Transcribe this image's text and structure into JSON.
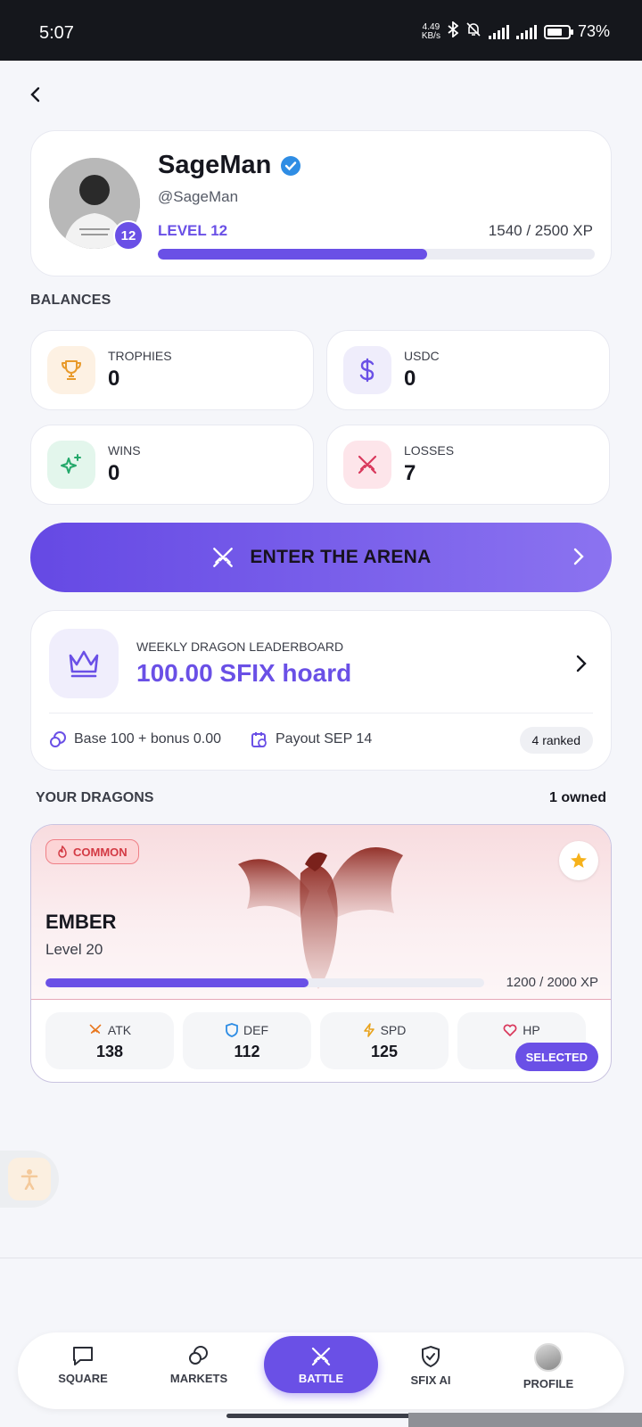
{
  "status_bar": {
    "time": "5:07",
    "net_speed_value": "4.49",
    "net_speed_unit": "KB/s",
    "battery": "73%"
  },
  "profile": {
    "name": "SageMan",
    "handle": "@SageMan",
    "level_badge": "12",
    "level_label": "LEVEL 12",
    "xp_text": "1540 / 2500 XP",
    "xp_current": 1540,
    "xp_max": 2500
  },
  "balances": {
    "title": "BALANCES",
    "items": [
      {
        "label": "TROPHIES",
        "value": "0",
        "icon": "trophy-icon"
      },
      {
        "label": "USDC",
        "value": "0",
        "icon": "dollar-icon"
      },
      {
        "label": "WINS",
        "value": "0",
        "icon": "sparkle-icon"
      },
      {
        "label": "LOSSES",
        "value": "7",
        "icon": "swords-icon"
      }
    ]
  },
  "arena": {
    "label": "ENTER THE ARENA"
  },
  "leaderboard": {
    "label": "WEEKLY DRAGON LEADERBOARD",
    "value": "100.00 SFIX hoard",
    "base": "Base 100 + bonus 0.00",
    "payout": "Payout SEP 14",
    "ranked": "4 ranked"
  },
  "dragons": {
    "title": "YOUR DRAGONS",
    "owned": "1 owned",
    "card": {
      "rarity": "COMMON",
      "name": "EMBER",
      "level": "Level 20",
      "xp_text": "1200 / 2000 XP",
      "xp_current": 1200,
      "xp_max": 2000,
      "stats": [
        {
          "label": "ATK",
          "value": "138"
        },
        {
          "label": "DEF",
          "value": "112"
        },
        {
          "label": "SPD",
          "value": "125"
        },
        {
          "label": "HP",
          "value": ""
        }
      ],
      "selected_label": "SELECTED"
    }
  },
  "nav": {
    "items": [
      {
        "label": "SQUARE"
      },
      {
        "label": "MARKETS"
      },
      {
        "label": "BATTLE"
      },
      {
        "label": "SFIX AI"
      },
      {
        "label": "PROFILE"
      }
    ]
  },
  "colors": {
    "accent": "#6a50e6",
    "common_red": "#d33a44",
    "status_bar": "#15171c"
  }
}
